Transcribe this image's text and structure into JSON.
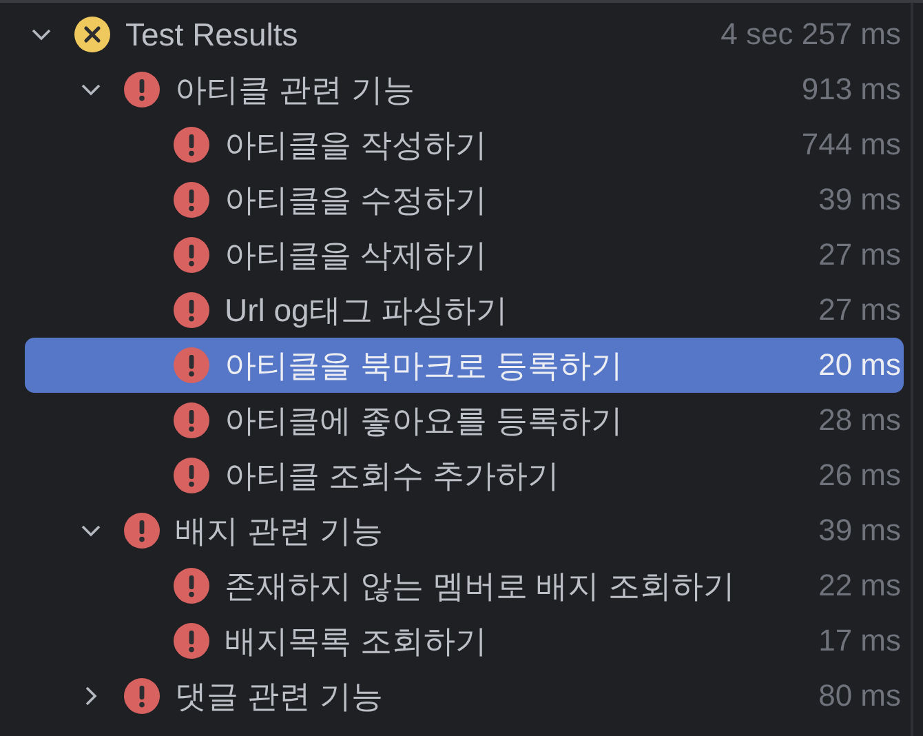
{
  "tree": {
    "label": "Test Results",
    "kind": "terminated",
    "time": "4 sec 257 ms",
    "expanded": true,
    "selected": false,
    "children": [
      {
        "label": "아티클 관련 기능",
        "kind": "failed",
        "time": "913 ms",
        "expanded": true,
        "selected": false,
        "children": [
          {
            "label": "아티클을 작성하기",
            "kind": "failed",
            "time": "744 ms",
            "selected": false
          },
          {
            "label": "아티클을 수정하기",
            "kind": "failed",
            "time": "39 ms",
            "selected": false
          },
          {
            "label": "아티클을 삭제하기",
            "kind": "failed",
            "time": "27 ms",
            "selected": false
          },
          {
            "label": "Url og태그 파싱하기",
            "kind": "failed",
            "time": "27 ms",
            "selected": false
          },
          {
            "label": "아티클을 북마크로 등록하기",
            "kind": "failed",
            "time": "20 ms",
            "selected": true
          },
          {
            "label": "아티클에 좋아요를 등록하기",
            "kind": "failed",
            "time": "28 ms",
            "selected": false
          },
          {
            "label": "아티클 조회수 추가하기",
            "kind": "failed",
            "time": "26 ms",
            "selected": false
          }
        ]
      },
      {
        "label": "배지 관련 기능",
        "kind": "failed",
        "time": "39 ms",
        "expanded": true,
        "selected": false,
        "children": [
          {
            "label": "존재하지 않는 멤버로 배지 조회하기",
            "kind": "failed",
            "time": "22 ms",
            "selected": false
          },
          {
            "label": "배지목록 조회하기",
            "kind": "failed",
            "time": "17 ms",
            "selected": false
          }
        ]
      },
      {
        "label": "댓글 관련 기능",
        "kind": "failed",
        "time": "80 ms",
        "expanded": false,
        "selected": false
      }
    ]
  }
}
